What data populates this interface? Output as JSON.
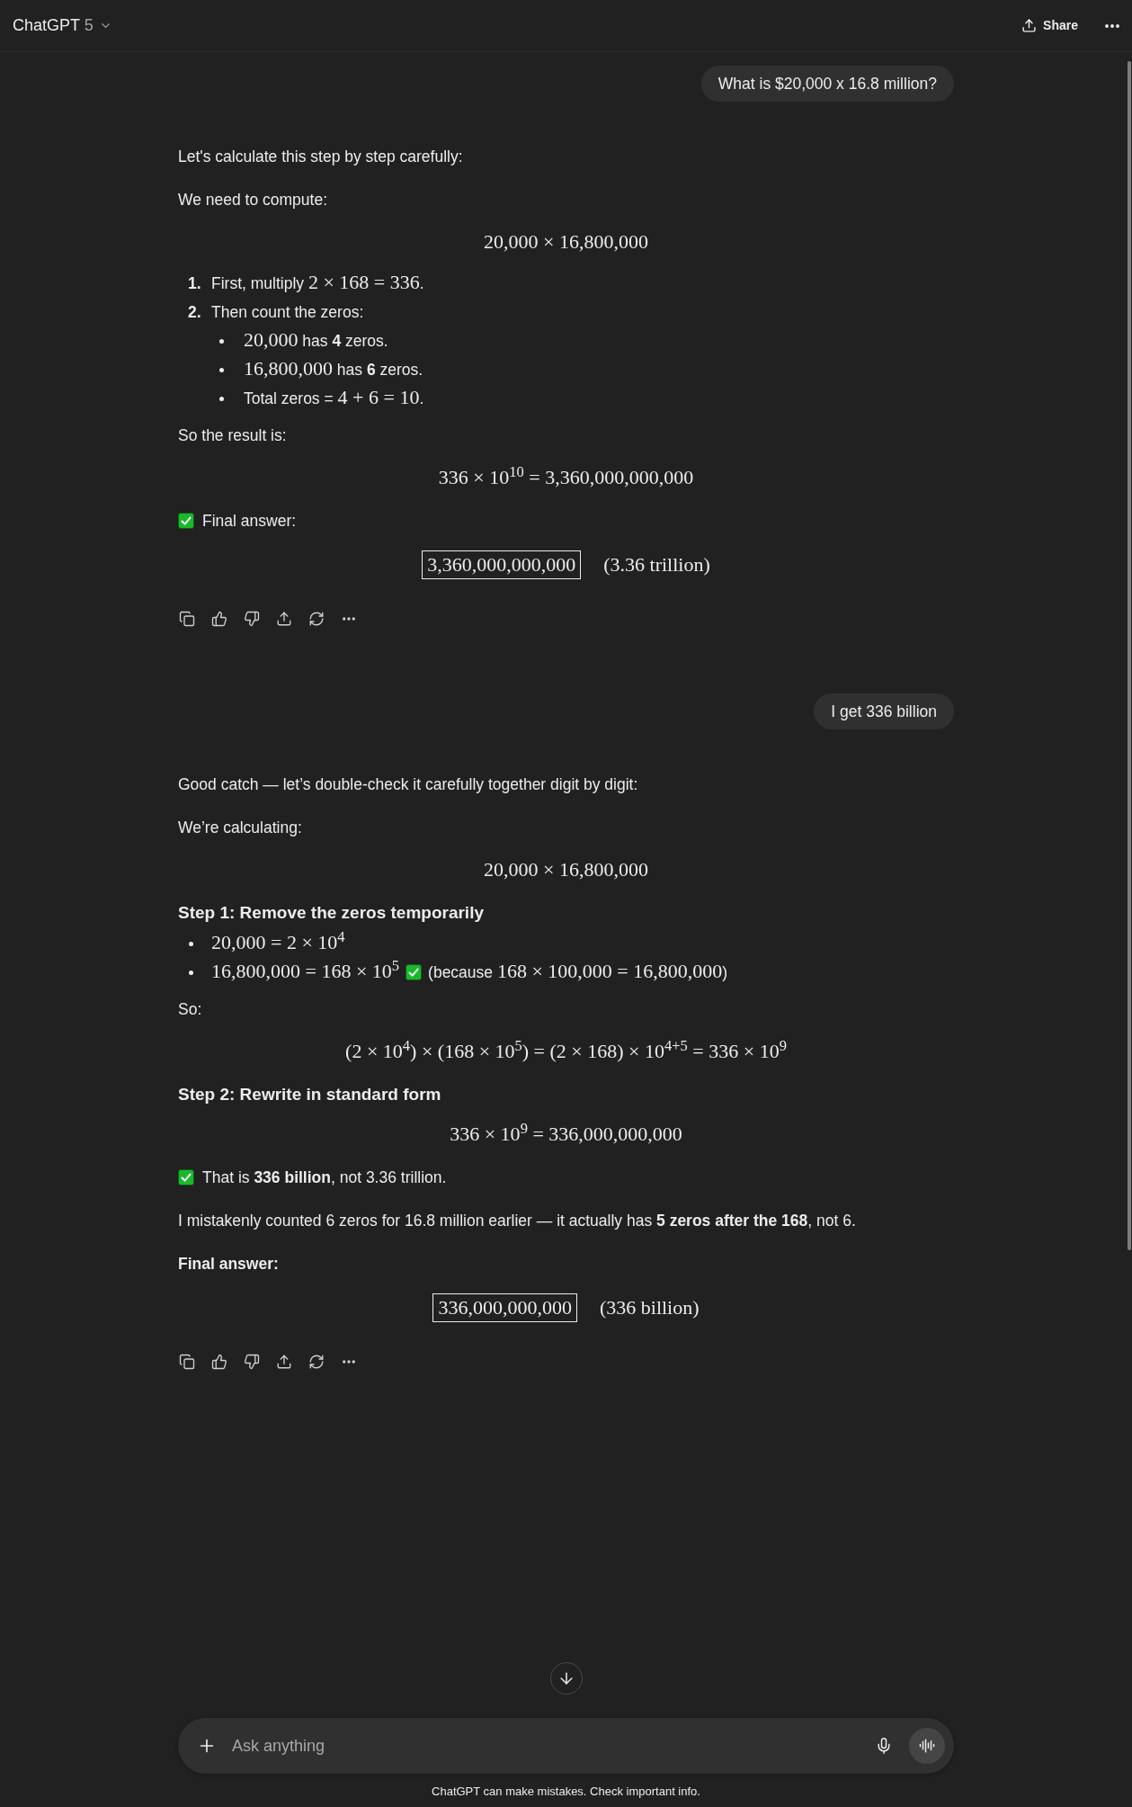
{
  "header": {
    "title": "ChatGPT",
    "model": "5",
    "share_label": "Share"
  },
  "messages": [
    {
      "kind": "user_message",
      "text": "What is $20,000 x 16.8 million?"
    },
    {
      "kind": "assistant_message",
      "blocks": [
        {
          "kind": "paragraph",
          "runs": [
            {
              "kind": "text",
              "text": "Let's calculate this step by step carefully:"
            }
          ]
        },
        {
          "kind": "paragraph",
          "runs": [
            {
              "kind": "text",
              "text": "We need to compute:"
            }
          ]
        },
        {
          "kind": "math",
          "text": "20,000 × 16,800,000"
        },
        {
          "kind": "ordered_list",
          "items": [
            {
              "marker": "1.",
              "runs": [
                {
                  "kind": "text",
                  "text": "First, multiply "
                },
                {
                  "kind": "math",
                  "text": "2 × 168 = 336"
                },
                {
                  "kind": "text",
                  "text": "."
                }
              ]
            },
            {
              "marker": "2.",
              "runs": [
                {
                  "kind": "text",
                  "text": "Then count the zeros:"
                }
              ],
              "children": [
                {
                  "runs": [
                    {
                      "kind": "math",
                      "text": "20,000"
                    },
                    {
                      "kind": "text",
                      "text": " has **4** zeros."
                    }
                  ]
                },
                {
                  "runs": [
                    {
                      "kind": "math",
                      "text": "16,800,000"
                    },
                    {
                      "kind": "text",
                      "text": " has **6** zeros."
                    }
                  ]
                },
                {
                  "runs": [
                    {
                      "kind": "text",
                      "text": "Total zeros = "
                    },
                    {
                      "kind": "math",
                      "text": "4 + 6 = 10"
                    },
                    {
                      "kind": "text",
                      "text": "."
                    }
                  ]
                }
              ]
            }
          ]
        },
        {
          "kind": "paragraph",
          "runs": [
            {
              "kind": "text",
              "text": "So the result is:"
            }
          ]
        },
        {
          "kind": "math",
          "text": "336 × 10$^{10}$ = 3,360,000,000,000"
        },
        {
          "kind": "paragraph",
          "runs": [
            {
              "kind": "emoji"
            },
            {
              "kind": "text",
              "text": "Final answer:"
            }
          ]
        },
        {
          "kind": "boxed",
          "value": "3,360,000,000,000",
          "note": "(3.36 trillion)"
        }
      ]
    },
    {
      "kind": "user_message",
      "text": "I get 336 billion"
    },
    {
      "kind": "assistant_message",
      "blocks": [
        {
          "kind": "paragraph",
          "runs": [
            {
              "kind": "text",
              "text": "Good catch — let’s double-check it carefully together digit by digit:"
            }
          ]
        },
        {
          "kind": "paragraph",
          "runs": [
            {
              "kind": "text",
              "text": "We’re calculating:"
            }
          ]
        },
        {
          "kind": "math",
          "text": "20,000 × 16,800,000"
        },
        {
          "kind": "heading",
          "text": "Step 1: Remove the zeros temporarily"
        },
        {
          "kind": "bullet_list",
          "items": [
            {
              "runs": [
                {
                  "kind": "math",
                  "text": "20,000 = 2 × 10$^{4}$"
                }
              ]
            },
            {
              "runs": [
                {
                  "kind": "math",
                  "text": "16,800,000 = 168 × 10$^{5}$"
                },
                {
                  "kind": "emoji"
                },
                {
                  "kind": "text",
                  "text": "(because "
                },
                {
                  "kind": "math",
                  "text": "168 × 100,000 = 16,800,000"
                },
                {
                  "kind": "text",
                  "text": ")"
                }
              ]
            }
          ]
        },
        {
          "kind": "paragraph",
          "runs": [
            {
              "kind": "text",
              "text": "So:"
            }
          ]
        },
        {
          "kind": "math",
          "text": "(2 × 10$^{4}$) × (168 × 10$^{5}$) = (2 × 168) × 10$^{4+5}$ = 336 × 10$^{9}$"
        },
        {
          "kind": "heading",
          "text": "Step 2: Rewrite in standard form"
        },
        {
          "kind": "math",
          "text": "336 × 10$^{9}$ = 336,000,000,000"
        },
        {
          "kind": "paragraph",
          "runs": [
            {
              "kind": "emoji"
            },
            {
              "kind": "text",
              "text": "That is **336 billion**, not 3.36 trillion."
            }
          ]
        },
        {
          "kind": "paragraph",
          "runs": [
            {
              "kind": "text",
              "text": "I mistakenly counted 6 zeros for 16.8 million earlier — it actually has **5 zeros after the 168**, not 6."
            }
          ]
        },
        {
          "kind": "strong",
          "text": "Final answer:"
        },
        {
          "kind": "boxed",
          "value": "336,000,000,000",
          "note": "(336 billion)"
        }
      ]
    }
  ],
  "composer": {
    "placeholder": "Ask anything"
  },
  "disclaimer": "ChatGPT can make mistakes. Check important info."
}
